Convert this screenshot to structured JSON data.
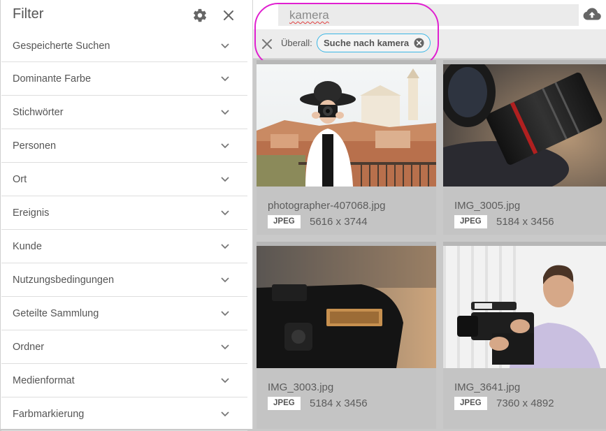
{
  "sidebar": {
    "title": "Filter",
    "items": [
      {
        "label": "Gespeicherte Suchen"
      },
      {
        "label": "Dominante Farbe"
      },
      {
        "label": "Stichwörter"
      },
      {
        "label": "Personen"
      },
      {
        "label": "Ort"
      },
      {
        "label": "Ereignis"
      },
      {
        "label": "Kunde"
      },
      {
        "label": "Nutzungsbedingungen"
      },
      {
        "label": "Geteilte Sammlung"
      },
      {
        "label": "Ordner"
      },
      {
        "label": "Medienformat"
      },
      {
        "label": "Farbmarkierung"
      }
    ]
  },
  "search": {
    "value": "kamera"
  },
  "filter_bar": {
    "scope_label": "Überall:",
    "chip_label": "Suche nach kamera"
  },
  "assets": [
    {
      "name": "photographer-407068.jpg",
      "type": "JPEG",
      "dims": "5616 x 3744"
    },
    {
      "name": "IMG_3005.jpg",
      "type": "JPEG",
      "dims": "5184 x 3456"
    },
    {
      "name": "IMG_3003.jpg",
      "type": "JPEG",
      "dims": "5184 x 3456"
    },
    {
      "name": "IMG_3641.jpg",
      "type": "JPEG",
      "dims": "7360 x 4892"
    }
  ],
  "colors": {
    "accent_chip_border": "#3ab6e5",
    "highlight_annotation": "#e020d0"
  }
}
